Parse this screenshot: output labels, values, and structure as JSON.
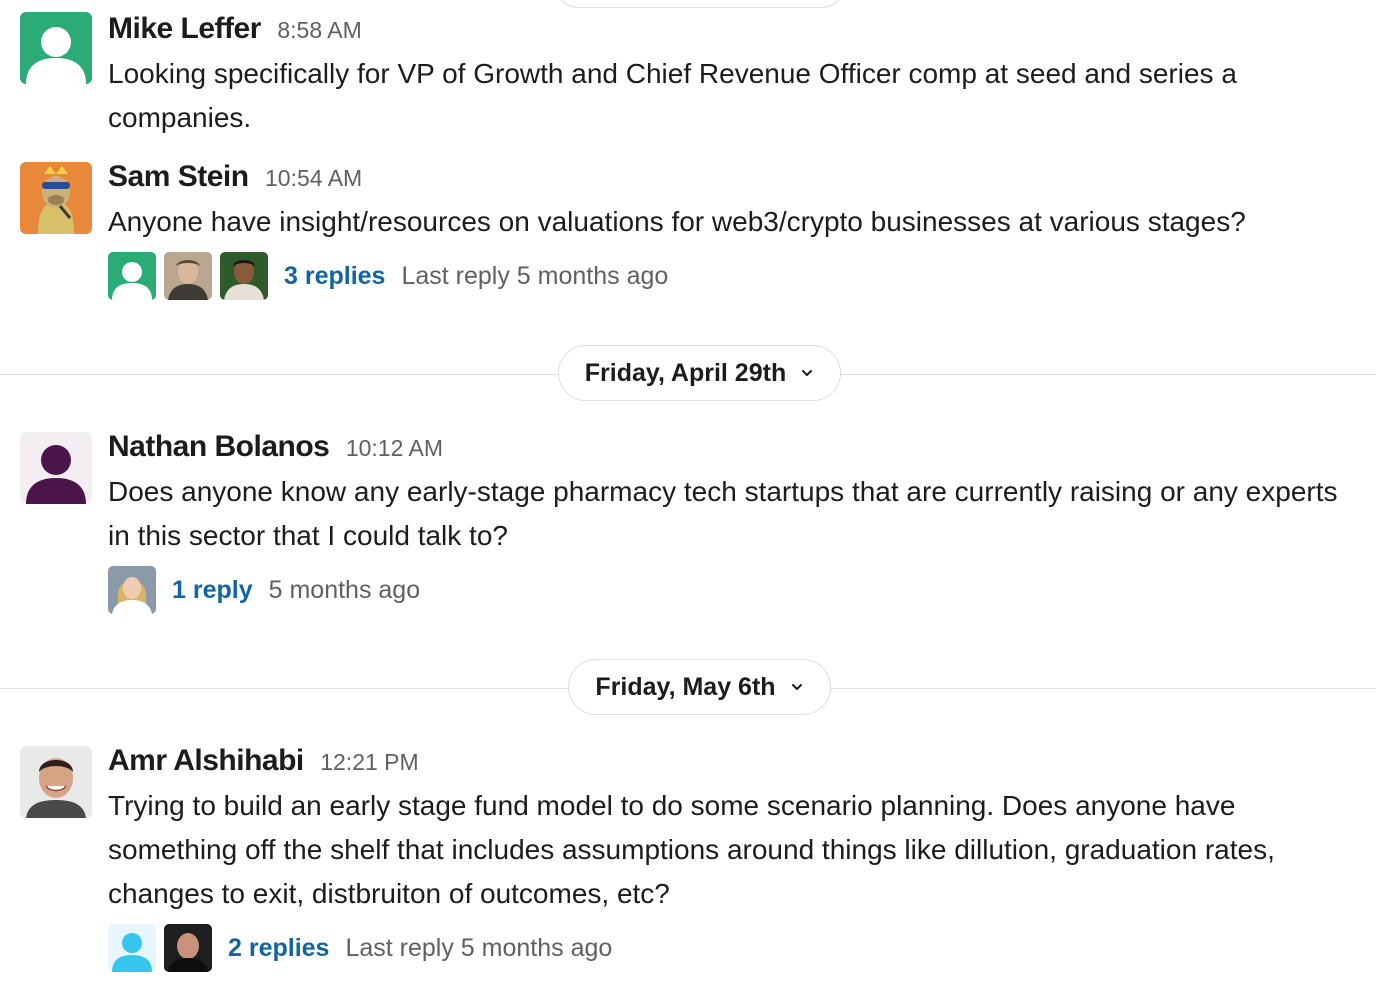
{
  "messages": [
    {
      "name": "Mike Leffer",
      "time": "8:58 AM",
      "text": "Looking specifically for VP of Growth and Chief Revenue Officer comp at seed and series a companies."
    },
    {
      "name": "Sam Stein",
      "time": "10:54 AM",
      "text": "Anyone have insight/resources on valuations for web3/crypto businesses at various stages?",
      "thread": {
        "replies": "3 replies",
        "meta": "Last reply 5 months ago"
      }
    },
    {
      "name": "Nathan Bolanos",
      "time": "10:12 AM",
      "text": "Does anyone know any early-stage pharmacy tech startups that are currently raising or any experts in this sector that I could talk to?",
      "thread": {
        "replies": "1 reply",
        "meta": "5 months ago"
      }
    },
    {
      "name": "Amr Alshihabi",
      "time": "12:21 PM",
      "text": "Trying to build an early stage fund model to do some scenario planning. Does anyone have something off the shelf that includes assumptions around things like dillution, graduation rates, changes to exit, distbruiton of outcomes, etc?",
      "thread": {
        "replies": "2 replies",
        "meta": "Last reply 5 months ago"
      }
    }
  ],
  "date_dividers": [
    "Friday, April 29th",
    "Friday, May 6th"
  ],
  "icons": {
    "default_avatar_green": "person-icon",
    "default_avatar_purple": "person-icon",
    "default_avatar_blue": "person-icon",
    "chevron": "chevron-down-icon"
  },
  "colors": {
    "link": "#1264a3",
    "avatar_green": "#2bac76",
    "avatar_purple": "#4a154b",
    "avatar_blue": "#36c5f0",
    "muted_text": "#616061"
  }
}
